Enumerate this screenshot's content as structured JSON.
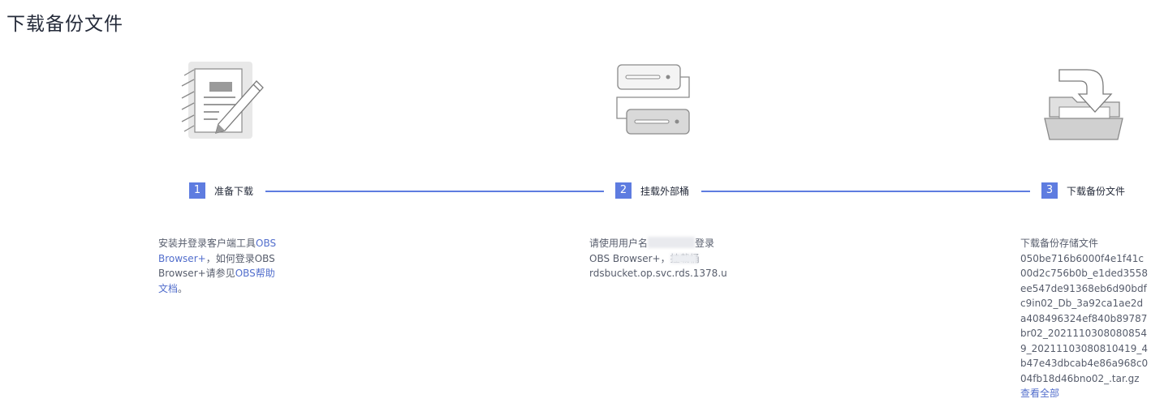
{
  "page": {
    "title": "下载备份文件"
  },
  "steps": [
    {
      "number": "1",
      "label": "准备下载"
    },
    {
      "number": "2",
      "label": "挂载外部桶"
    },
    {
      "number": "3",
      "label": "下载备份文件"
    }
  ],
  "step1": {
    "text_a": "安装并登录客户端工具",
    "link_obs_browser": "OBS Browser+",
    "text_b": "，如何登录OBS Browser+请参见",
    "link_help": "OBS帮助文档",
    "text_c": "。"
  },
  "step2": {
    "text_a": "请使用用户名",
    "text_b": "登录",
    "text_c": "OBS Browser+，挂载桶",
    "bucket": "rdsbucket.op.svc.rds.1378.u"
  },
  "step3": {
    "heading": "下载备份存储文件",
    "filename": "050be716b6000f4e1f41c00d2c756b0b_e1ded3558ee547de91368eb6d90bdfc9in02_Db_3a92ca1ae2da408496324ef840b89787br02_20211103080808549_20211103080810419_4b47e43dbcab4e86a968c004fb18d46bno02_.tar.gz",
    "view_all": "查看全部"
  },
  "colors": {
    "accent": "#5e7ce0",
    "link": "#526ecc",
    "title": "#252b3a"
  }
}
